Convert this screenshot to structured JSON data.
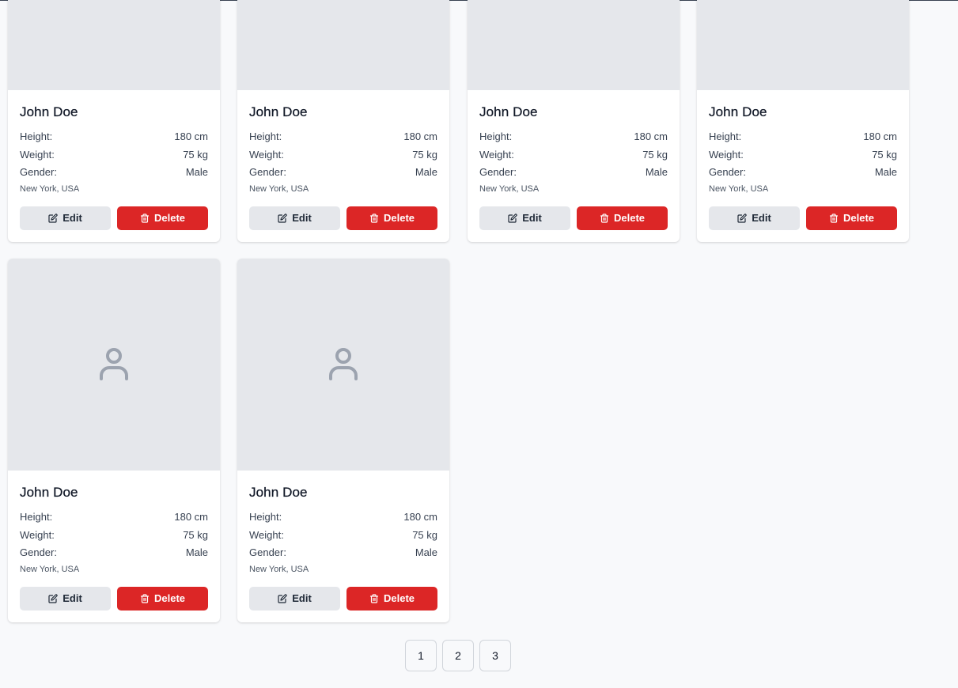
{
  "cards": [
    {
      "name": "John Doe",
      "height_label": "Height:",
      "height": "180 cm",
      "weight_label": "Weight:",
      "weight": "75 kg",
      "gender_label": "Gender:",
      "gender": "Male",
      "location": "New York, USA",
      "edit_label": "Edit",
      "delete_label": "Delete"
    },
    {
      "name": "John Doe",
      "height_label": "Height:",
      "height": "180 cm",
      "weight_label": "Weight:",
      "weight": "75 kg",
      "gender_label": "Gender:",
      "gender": "Male",
      "location": "New York, USA",
      "edit_label": "Edit",
      "delete_label": "Delete"
    },
    {
      "name": "John Doe",
      "height_label": "Height:",
      "height": "180 cm",
      "weight_label": "Weight:",
      "weight": "75 kg",
      "gender_label": "Gender:",
      "gender": "Male",
      "location": "New York, USA",
      "edit_label": "Edit",
      "delete_label": "Delete"
    },
    {
      "name": "John Doe",
      "height_label": "Height:",
      "height": "180 cm",
      "weight_label": "Weight:",
      "weight": "75 kg",
      "gender_label": "Gender:",
      "gender": "Male",
      "location": "New York, USA",
      "edit_label": "Edit",
      "delete_label": "Delete"
    },
    {
      "name": "John Doe",
      "height_label": "Height:",
      "height": "180 cm",
      "weight_label": "Weight:",
      "weight": "75 kg",
      "gender_label": "Gender:",
      "gender": "Male",
      "location": "New York, USA",
      "edit_label": "Edit",
      "delete_label": "Delete"
    },
    {
      "name": "John Doe",
      "height_label": "Height:",
      "height": "180 cm",
      "weight_label": "Weight:",
      "weight": "75 kg",
      "gender_label": "Gender:",
      "gender": "Male",
      "location": "New York, USA",
      "edit_label": "Edit",
      "delete_label": "Delete"
    }
  ],
  "pagination": {
    "pages": [
      "1",
      "2",
      "3"
    ]
  },
  "icons": {
    "placeholder": "user-icon",
    "edit": "edit-icon",
    "delete": "trash-icon"
  },
  "colors": {
    "delete": "#dc2626",
    "edit": "#e5e7eb",
    "photo_placeholder": "#e5e7eb",
    "page_background": "#f8f9fb"
  }
}
